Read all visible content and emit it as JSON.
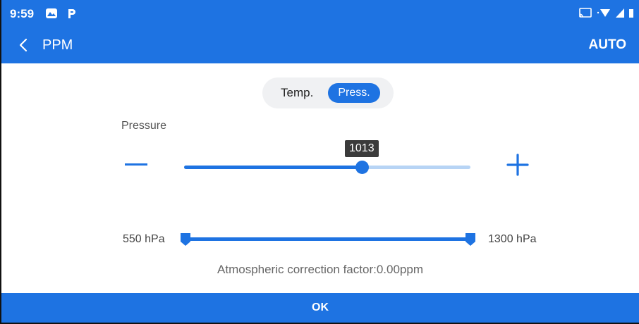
{
  "status_bar": {
    "time": "9:59",
    "notification_icons": [
      "photos-icon",
      "p-app-icon"
    ],
    "system_icons": [
      "cast-icon",
      "wifi-icon",
      "signal-icon",
      "battery-icon"
    ]
  },
  "app_bar": {
    "back_icon": "chevron-left-icon",
    "title": "PPM",
    "action_label": "AUTO"
  },
  "mode_toggle": {
    "options": [
      "Temp.",
      "Press."
    ],
    "selected": "Press."
  },
  "pressure": {
    "label": "Pressure",
    "value": "1013",
    "fill_fraction": 0.62,
    "decrement_icon": "minus-icon",
    "increment_icon": "plus-icon"
  },
  "range": {
    "min_label": "550 hPa",
    "max_label": "1300 hPa"
  },
  "correction_text": "Atmospheric correction factor:0.00ppm",
  "ok_label": "OK",
  "colors": {
    "accent": "#1e73e2",
    "track_light": "#b7d4f5",
    "tooltip_bg": "#3b3b3b",
    "segment_bg": "#f0f1f3"
  }
}
